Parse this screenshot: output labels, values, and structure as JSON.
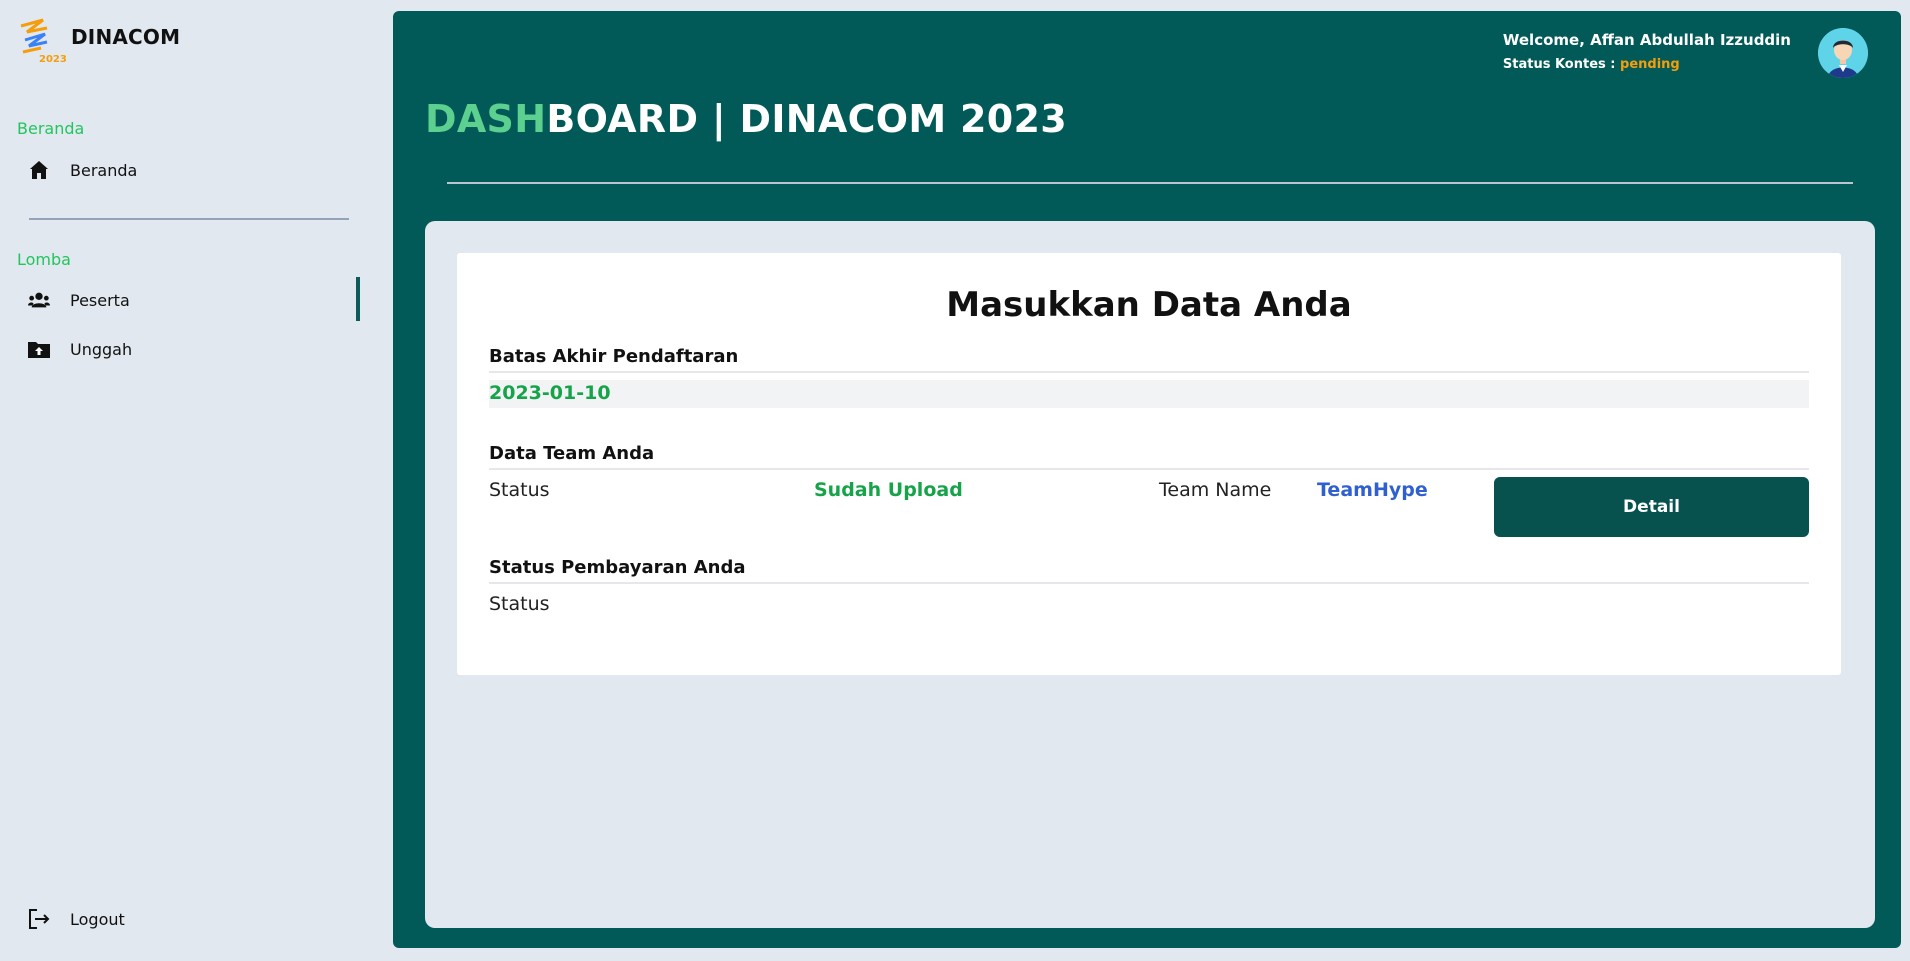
{
  "brand": {
    "name": "DINACOM",
    "logo_text": "2023"
  },
  "sidebar": {
    "sections": [
      {
        "label": "Beranda",
        "items": [
          {
            "label": "Beranda",
            "icon": "home-icon"
          }
        ]
      },
      {
        "label": "Lomba",
        "items": [
          {
            "label": "Peserta",
            "icon": "users-icon",
            "active": true
          },
          {
            "label": "Unggah",
            "icon": "folder-upload-icon"
          }
        ]
      }
    ],
    "logout_label": "Logout"
  },
  "header": {
    "welcome": "Welcome, Affan Abdullah Izzuddin",
    "status_label": "Status Kontes :",
    "status_value": "pending",
    "title_accent": "DASH",
    "title_rest": "BOARD | DINACOM 2023"
  },
  "card": {
    "title": "Masukkan Data Anda",
    "deadline_heading": "Batas Akhir Pendaftaran",
    "deadline_value": "2023-01-10",
    "team_heading": "Data Team Anda",
    "team_status_label": "Status",
    "team_status_value": "Sudah Upload",
    "team_name_label": "Team Name",
    "team_name_value": "TeamHype",
    "detail_button": "Detail",
    "payment_heading": "Status Pembayaran Anda",
    "payment_status_label": "Status"
  },
  "colors": {
    "primary": "#025a58",
    "accent_green": "#22c55e",
    "pending": "#f59e0b",
    "team_name": "#2f5fd0"
  }
}
